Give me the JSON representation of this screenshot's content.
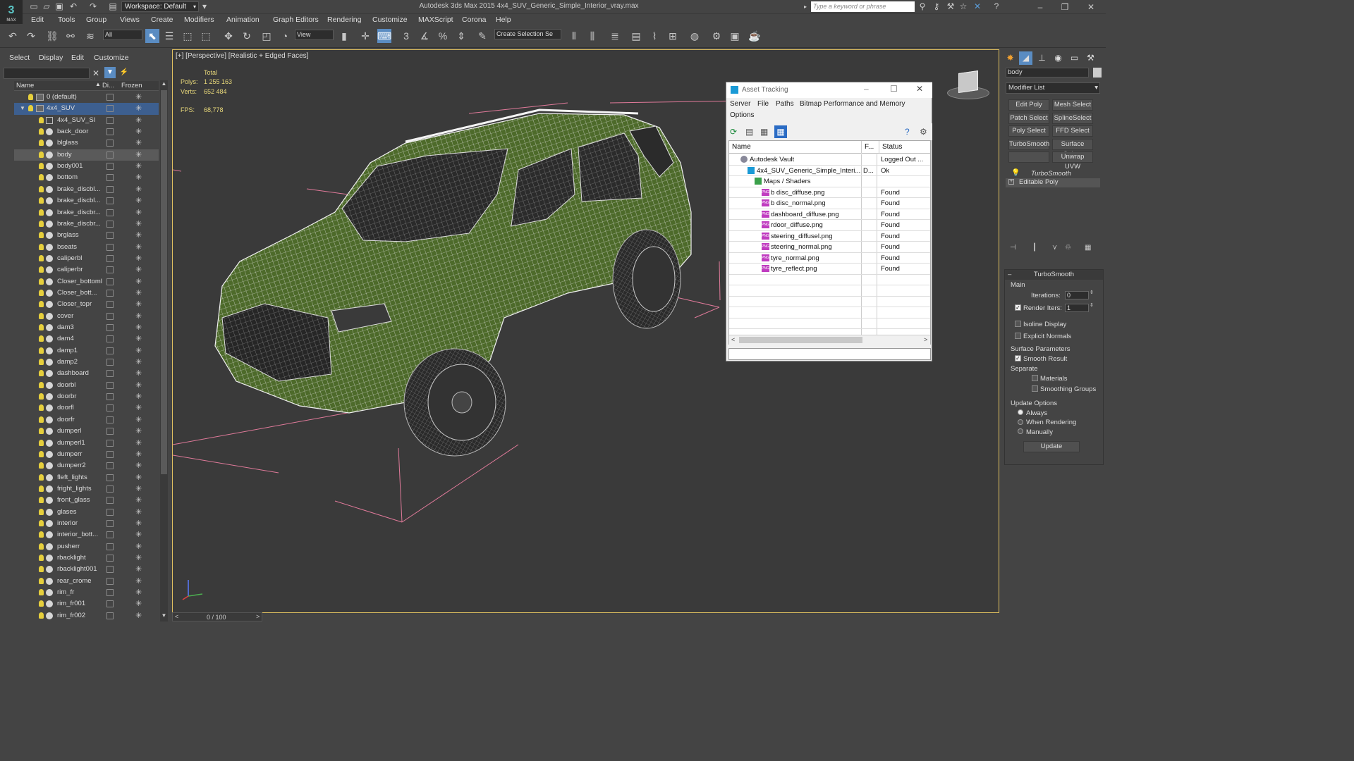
{
  "app": {
    "logo_text": "MAX",
    "title": "Autodesk 3ds Max  2015     4x4_SUV_Generic_Simple_Interior_vray.max",
    "workspace": "Workspace: Default",
    "search_placeholder": "Type a keyword or phrase"
  },
  "menu": [
    "Edit",
    "Tools",
    "Group",
    "Views",
    "Create",
    "Modifiers",
    "Animation",
    "Graph Editors",
    "Rendering",
    "Customize",
    "MAXScript",
    "Corona",
    "Help"
  ],
  "toolbar": {
    "filter": "All",
    "refcoord": "View",
    "selection_set": "Create Selection Se",
    "snap_label": "3",
    "percent_label": "%"
  },
  "scene_explorer": {
    "menu": [
      "Select",
      "Display",
      "Edit",
      "Customize"
    ],
    "columns": {
      "name": "Name",
      "display": "Di...",
      "frozen": "Frozen"
    },
    "rows": [
      {
        "name": "0 (default)",
        "type": "layer",
        "level": 0
      },
      {
        "name": "4x4_SUV",
        "type": "layer",
        "level": 0,
        "selected": true
      },
      {
        "name": "4x4_SUV_SI",
        "type": "group",
        "level": 1
      },
      {
        "name": "back_door",
        "level": 1
      },
      {
        "name": "blglass",
        "level": 1
      },
      {
        "name": "body",
        "level": 1,
        "highlight": true
      },
      {
        "name": "body001",
        "level": 1
      },
      {
        "name": "bottom",
        "level": 1
      },
      {
        "name": "brake_discbl...",
        "level": 1
      },
      {
        "name": "brake_discbl...",
        "level": 1
      },
      {
        "name": "brake_discbr...",
        "level": 1
      },
      {
        "name": "brake_discbr...",
        "level": 1
      },
      {
        "name": "brglass",
        "level": 1
      },
      {
        "name": "bseats",
        "level": 1
      },
      {
        "name": "caliperbl",
        "level": 1
      },
      {
        "name": "caliperbr",
        "level": 1
      },
      {
        "name": "Closer_bottoml",
        "level": 1
      },
      {
        "name": "Closer_bott...",
        "level": 1
      },
      {
        "name": "Closer_topr",
        "level": 1
      },
      {
        "name": "cover",
        "level": 1
      },
      {
        "name": "dam3",
        "level": 1
      },
      {
        "name": "dam4",
        "level": 1
      },
      {
        "name": "damp1",
        "level": 1
      },
      {
        "name": "damp2",
        "level": 1
      },
      {
        "name": "dashboard",
        "level": 1
      },
      {
        "name": "doorbl",
        "level": 1
      },
      {
        "name": "doorbr",
        "level": 1
      },
      {
        "name": "doorfl",
        "level": 1
      },
      {
        "name": "doorfr",
        "level": 1
      },
      {
        "name": "dumperl",
        "level": 1
      },
      {
        "name": "dumperl1",
        "level": 1
      },
      {
        "name": "dumperr",
        "level": 1
      },
      {
        "name": "dumperr2",
        "level": 1
      },
      {
        "name": "fleft_lights",
        "level": 1
      },
      {
        "name": "fright_lights",
        "level": 1
      },
      {
        "name": "front_glass",
        "level": 1
      },
      {
        "name": "glases",
        "level": 1
      },
      {
        "name": "interior",
        "level": 1
      },
      {
        "name": "interior_bott...",
        "level": 1
      },
      {
        "name": "pusherr",
        "level": 1
      },
      {
        "name": "rbacklight",
        "level": 1
      },
      {
        "name": "rbacklight001",
        "level": 1
      },
      {
        "name": "rear_crome",
        "level": 1
      },
      {
        "name": "rim_fr",
        "level": 1
      },
      {
        "name": "rim_fr001",
        "level": 1
      },
      {
        "name": "rim_fr002",
        "level": 1
      }
    ]
  },
  "viewport": {
    "label": "[+] [Perspective] [Realistic + Edged Faces]",
    "stats_total": "Total",
    "polys_label": "Polys:",
    "polys_value": "1 255 163",
    "verts_label": "Verts:",
    "verts_value": "652 484",
    "fps_label": "FPS:",
    "fps_value": "68,778",
    "timeline": "0 / 100",
    "wire_color": "#e8e8e8",
    "body_color": "#4d6a2a"
  },
  "asset_tracking": {
    "title": "Asset Tracking",
    "menu": [
      "Server",
      "File",
      "Paths",
      "Bitmap Performance and Memory",
      "Options"
    ],
    "columns": {
      "name": "Name",
      "f": "F...",
      "status": "Status"
    },
    "rows": [
      {
        "name": "Autodesk Vault",
        "f": "",
        "status": "Logged Out ...",
        "indent": 1,
        "icon": "vault"
      },
      {
        "name": "4x4_SUV_Generic_Simple_Interi...",
        "f": "D...",
        "status": "Ok",
        "indent": 2,
        "icon": "max"
      },
      {
        "name": "Maps / Shaders",
        "f": "",
        "status": "",
        "indent": 3,
        "icon": "maps"
      },
      {
        "name": "b disc_diffuse.png",
        "f": "",
        "status": "Found",
        "indent": 4,
        "icon": "png"
      },
      {
        "name": "b disc_normal.png",
        "f": "",
        "status": "Found",
        "indent": 4,
        "icon": "png"
      },
      {
        "name": "dashboard_diffuse.png",
        "f": "",
        "status": "Found",
        "indent": 4,
        "icon": "png"
      },
      {
        "name": "rdoor_diffuse.png",
        "f": "",
        "status": "Found",
        "indent": 4,
        "icon": "png"
      },
      {
        "name": "steering_diffusel.png",
        "f": "",
        "status": "Found",
        "indent": 4,
        "icon": "png"
      },
      {
        "name": "steering_normal.png",
        "f": "",
        "status": "Found",
        "indent": 4,
        "icon": "png"
      },
      {
        "name": "tyre_normal.png",
        "f": "",
        "status": "Found",
        "indent": 4,
        "icon": "png"
      },
      {
        "name": "tyre_reflect.png",
        "f": "",
        "status": "Found",
        "indent": 4,
        "icon": "png"
      }
    ]
  },
  "command_panel": {
    "object_name": "body",
    "modifier_list": "Modifier List",
    "buttons": [
      [
        "Edit Poly",
        "Mesh Select"
      ],
      [
        "Patch Select",
        "SplineSelect"
      ],
      [
        "Poly Select",
        "FFD Select"
      ],
      [
        "TurboSmooth",
        "Surface Select"
      ],
      [
        "",
        "Unwrap UVW"
      ]
    ],
    "stack": [
      "TurboSmooth",
      "Editable Poly"
    ],
    "rollout_title": "TurboSmooth",
    "main": "Main",
    "iterations_label": "Iterations:",
    "iterations": "0",
    "render_iters_label": "Render Iters:",
    "render_iters": "1",
    "isoline": "Isoline Display",
    "explicit": "Explicit Normals",
    "surface_params": "Surface Parameters",
    "smooth_result": "Smooth Result",
    "separate": "Separate",
    "materials": "Materials",
    "smoothing_groups": "Smoothing Groups",
    "update_options": "Update Options",
    "always": "Always",
    "when_rendering": "When Rendering",
    "manually": "Manually",
    "update": "Update"
  }
}
